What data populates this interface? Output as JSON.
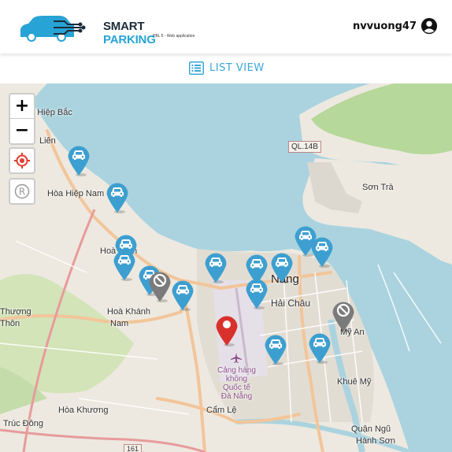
{
  "header": {
    "brand_part1": "SMART",
    "brand_part2": "PARKING",
    "brand_sub": "PBL 5 - Web application",
    "username": "nvvuong47"
  },
  "toolbar": {
    "list_view_label": "LIST VIEW"
  },
  "map_controls": {
    "zoom_in": "+",
    "zoom_out": "−"
  },
  "map_labels": {
    "hoa_hiep_bac": "Hòa Hiệp Bắc",
    "lien": "Liên",
    "hoa_hiep_nam": "Hòa Hiệp Nam",
    "hoa_minh": "Hoà Minh",
    "hoa_khanh_nam_1": "Hoà Khánh",
    "hoa_khanh_nam_2": "Nam",
    "thuong": "Thượng",
    "thon": "Thôn",
    "da_nang": "Nẵng",
    "hai_chau": "Hải Châu",
    "son_tra": "Sơn Trà",
    "my_an": "Mỹ An",
    "khue_my": "Khuê Mỹ",
    "hoa_khuong": "Hòa Khương",
    "cam_le": "Cẩm Lệ",
    "truc_dong": "Trúc Đông",
    "quan_ngu": "Quận Ngũ",
    "hanh_son": "Hành Sơn",
    "airport": [
      "Cảng hàng",
      "không",
      "Quốc tế",
      "Đà Nẵng"
    ],
    "highway": "QL.14B",
    "road_161": "161"
  },
  "colors": {
    "pin_available": "#3d9fd0",
    "pin_full": "#7b7b7b",
    "pin_selected": "#d8312b",
    "accent": "#3aa7d8",
    "water": "#aad3df"
  },
  "pins": [
    {
      "type": "available",
      "icon": "car-icon"
    },
    {
      "type": "available",
      "icon": "car-icon"
    },
    {
      "type": "available",
      "icon": "car-icon"
    },
    {
      "type": "available",
      "icon": "car-icon"
    },
    {
      "type": "available",
      "icon": "car-icon"
    },
    {
      "type": "full",
      "icon": "no-entry-icon"
    },
    {
      "type": "available",
      "icon": "car-icon"
    },
    {
      "type": "available",
      "icon": "car-icon"
    },
    {
      "type": "available",
      "icon": "car-icon"
    },
    {
      "type": "available",
      "icon": "car-icon"
    },
    {
      "type": "available",
      "icon": "car-icon"
    },
    {
      "type": "available",
      "icon": "car-icon"
    },
    {
      "type": "available",
      "icon": "car-icon"
    },
    {
      "type": "full",
      "icon": "no-entry-icon"
    },
    {
      "type": "selected",
      "icon": "location-dot-icon"
    },
    {
      "type": "available",
      "icon": "car-icon"
    },
    {
      "type": "available",
      "icon": "car-icon"
    }
  ]
}
